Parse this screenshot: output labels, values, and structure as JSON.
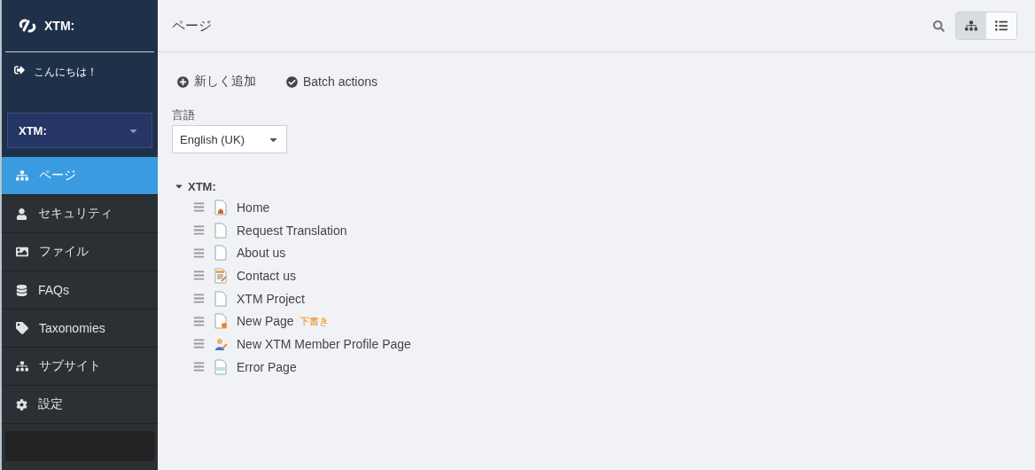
{
  "sidebar": {
    "brand": "XTM:",
    "greeting": "こんにちは！",
    "site_select": {
      "value": "XTM:"
    },
    "items": [
      {
        "label": "ページ",
        "kind": "sitemap",
        "selected": true
      },
      {
        "label": "セキュリティ",
        "kind": "user",
        "selected": false
      },
      {
        "label": "ファイル",
        "kind": "image",
        "selected": false
      },
      {
        "label": "FAQs",
        "kind": "database",
        "selected": false
      },
      {
        "label": "Taxonomies",
        "kind": "tag",
        "selected": false
      },
      {
        "label": "サブサイト",
        "kind": "sitemap",
        "selected": false
      },
      {
        "label": "設定",
        "kind": "gear",
        "selected": false
      }
    ]
  },
  "header": {
    "title": "ページ",
    "views": [
      {
        "kind": "tree",
        "selected": true
      },
      {
        "kind": "list",
        "selected": false
      }
    ]
  },
  "actions": [
    {
      "label": "新しく追加",
      "kind": "add"
    },
    {
      "label": "Batch actions",
      "kind": "batch"
    }
  ],
  "language": {
    "label": "言語",
    "value": "English (UK)"
  },
  "tree": {
    "root": "XTM:",
    "expanded": true,
    "children": [
      {
        "title": "Home",
        "kind": "home"
      },
      {
        "title": "Request Translation",
        "kind": "page"
      },
      {
        "title": "About us",
        "kind": "page"
      },
      {
        "title": "Contact us",
        "kind": "form"
      },
      {
        "title": "XTM Project",
        "kind": "page"
      },
      {
        "title": "New Page",
        "kind": "draft",
        "badge": "下書き"
      },
      {
        "title": "New XTM Member Profile Page",
        "kind": "profile"
      },
      {
        "title": "Error Page",
        "kind": "error"
      }
    ]
  }
}
